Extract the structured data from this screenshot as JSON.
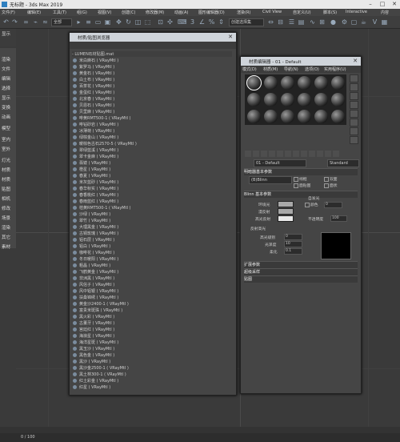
{
  "app": {
    "title": "无标题 - 3ds Max 2019"
  },
  "menubar": [
    "文件(F)",
    "编辑(E)",
    "工具(T)",
    "组(G)",
    "视图(V)",
    "创建(C)",
    "修改器(M)",
    "动画(A)",
    "图形编辑器(D)",
    "渲染(R)",
    "Civil View",
    "自定义(U)",
    "脚本(S)",
    "Interactive",
    "内容"
  ],
  "toolbar": {
    "selection_filter": "全部",
    "named_selection": "创建选择集"
  },
  "leftpanel": [
    "显示",
    "渲染",
    "文件",
    "编辑",
    "选择",
    "显示",
    "变换",
    "动画",
    "模型",
    "室内",
    "室外",
    "灯光",
    "材质",
    "材质",
    "贴图",
    "相机",
    "修改",
    "场景",
    "渲染",
    "其它",
    "素材"
  ],
  "browser": {
    "title": "材质/贴图浏览器",
    "header": "- LUMEN石材贴图.mat",
    "items": [
      "米白麻石 ( VRayMtl )",
      "紫罗马 ( VRayMtl )",
      "黄金石 ( VRayMtl )",
      "白土布 ( VRayMtl )",
      "百茶花 ( VRayMtl )",
      "金蛋红 ( VRayMtl )",
      "北京春 ( VRayMtl )",
      "贝恩石 ( VRayMtl )",
      "贝里麻 ( VRayMtl )",
      "啡黄RMT500-1 ( VRayMtl )",
      "啡钻砂岩 ( VRayMtl )",
      "冰薄荷 ( VRayMtl )",
      "绿棕金山 ( VRayMtl )",
      "暖棕色古石2570-5 ( VRayMtl )",
      "翠绿蓝溪 ( VRayMtl )",
      "翠卡金麻 ( VRayMtl )",
      "翡镜 ( VRayMtl )",
      "橙星 ( VRayMtl )",
      "春夏 ( VRayMtl )",
      "米灰蓝砂 ( VRayMtl )",
      "春华秋实 ( VRayMtl )",
      "春香桃红 ( VRayMtl )",
      "春雨蓝红 ( VRayMtl )",
      "桔黄RMT500-1 ( VRayMtl )",
      "沙绿 ( VRayMtl )",
      "翠竹 ( VRayMtl )",
      "大理黑金 ( VRayMtl )",
      "古铜玫瑰 ( VRayMtl )",
      "铝石层 ( VRayMtl )",
      "铝白 ( VRayMtl )",
      "咖啡花 ( VRayMtl )",
      "冬日暖阳 ( VRayMtl )",
      "粗晶 ( VRayMtl )",
      "飞鹤黄金 ( VRayMtl )",
      "非洲黑 ( VRayMtl )",
      "风信子 ( VRayMtl )",
      "风中铝银 ( VRayMtl )",
      "扶桑锦绣 ( VRayMtl )",
      "黄金沙2400-1 ( VRayMtl )",
      "富贵米斑珠 ( VRayMtl )",
      "黑火彩 ( VRayMtl )",
      "古董牙 ( VRayMtl )",
      "宫廷红 ( VRayMtl )",
      "海浪星 ( VRayMtl )",
      "海洋星斑 ( VRayMtl )",
      "黑玉沙 ( VRayMtl )",
      "黑色金 ( VRayMtl )",
      "黑沙 ( VRayMtl )",
      "黑沙金2500-1 ( VRayMtl )",
      "黑土林300-1 ( VRayMtl )",
      "红土彩金 ( VRayMtl )",
      "红星 ( VRayMtl )"
    ]
  },
  "editor": {
    "title": "材质编辑器 - 01 - Default",
    "menu": [
      "模式(D)",
      "材质(M)",
      "导航(N)",
      "选项(O)",
      "实用程序(U)"
    ],
    "material_name": "01 - Default",
    "material_type": "Standard",
    "rollout_basic": "明暗器基本参数",
    "shader": "(B)Blinn",
    "checks": [
      "线框",
      "双面",
      "面贴图",
      "面状"
    ],
    "rollout_blinn": "Blinn 基本参数",
    "ambient": "环境光",
    "diffuse": "漫反射",
    "specular": "高光反射",
    "selfillum": "自发光",
    "color_label": "颜色",
    "color_value": "0",
    "opacity_label": "不透明度",
    "opacity_value": "100",
    "spec_title": "反射高光",
    "spec_level": "高光级别",
    "spec_level_value": "0",
    "glossiness": "光泽度",
    "glossiness_value": "10",
    "soften": "柔化",
    "soften_value": "0.1",
    "rollout_ext": "扩展参数",
    "rollout_ss": "超级采样",
    "rollout_maps": "贴图"
  },
  "status": {
    "frame": "0 / 100"
  }
}
